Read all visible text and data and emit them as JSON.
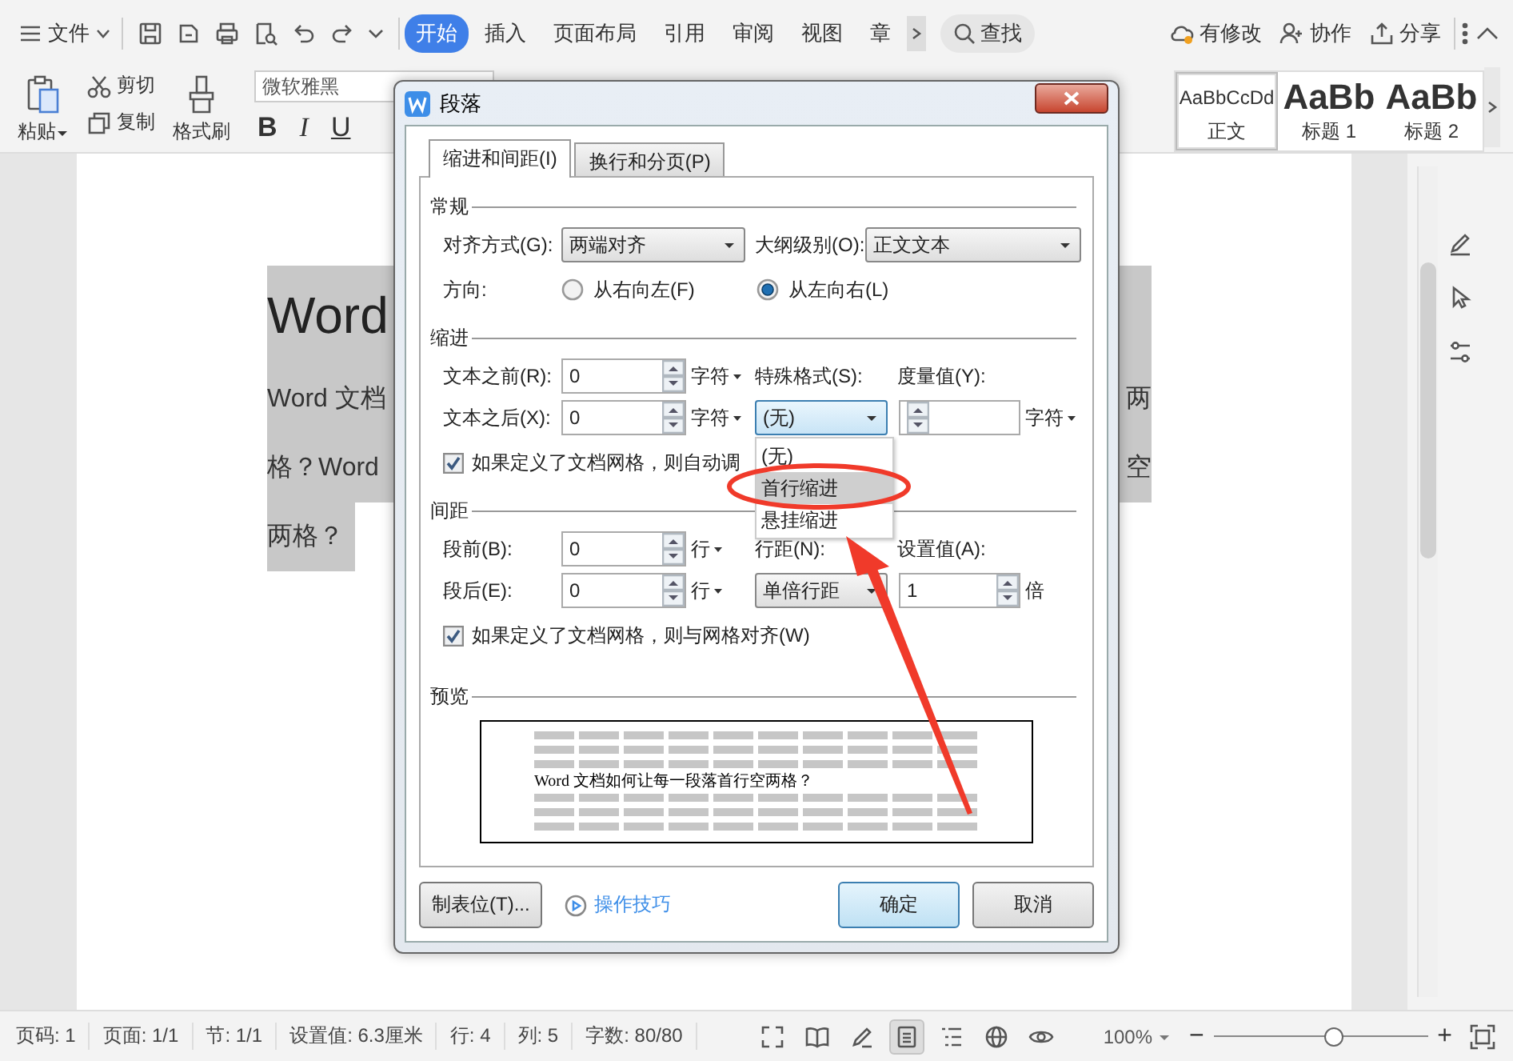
{
  "top_bar": {
    "file_menu": "文件"
  },
  "ribbon_tabs": [
    {
      "label": "开始",
      "selected": true
    },
    {
      "label": "插入",
      "selected": false
    },
    {
      "label": "页面布局",
      "selected": false
    },
    {
      "label": "引用",
      "selected": false
    },
    {
      "label": "审阅",
      "selected": false
    },
    {
      "label": "视图",
      "selected": false
    },
    {
      "label": "章",
      "selected": false
    }
  ],
  "search": {
    "label": "查找"
  },
  "right_actions": [
    {
      "kind": "cloud",
      "label": "有修改"
    },
    {
      "kind": "people",
      "label": "协作"
    },
    {
      "kind": "share",
      "label": "分享"
    }
  ],
  "ribbon": {
    "paste": "粘贴",
    "cut": "剪切",
    "copy": "复制",
    "format_painter": "格式刷",
    "font_name": "微软雅黑",
    "format_buttons": [
      {
        "kind": "bold",
        "label": "B"
      },
      {
        "kind": "italic",
        "label": "I"
      },
      {
        "kind": "underline",
        "label": "U"
      }
    ],
    "styles": [
      {
        "sample": "AaBbCcDd",
        "name": "正文",
        "selected": true
      },
      {
        "sample": "AaBb",
        "name": "标题 1",
        "selected": false
      },
      {
        "sample": "AaBb",
        "name": "标题 2",
        "selected": false
      }
    ]
  },
  "document": {
    "title": "Word",
    "lines": [
      {
        "left": "Word 文档",
        "right": "两"
      },
      {
        "left": "格？Word",
        "right": "空"
      },
      {
        "left": "两格？"
      }
    ]
  },
  "dialog": {
    "title": "段落",
    "tabs": [
      {
        "label": "缩进和间距(I)",
        "selected": true
      },
      {
        "label": "换行和分页(P)",
        "selected": false
      }
    ],
    "general": {
      "heading": "常规",
      "alignment": {
        "label": "对齐方式(G):",
        "value": "两端对齐"
      },
      "outline": {
        "label": "大纲级别(O):",
        "value": "正文文本"
      },
      "direction": {
        "label": "方向:",
        "options": [
          {
            "label": "从右向左(F)",
            "selected": false
          },
          {
            "label": "从左向右(L)",
            "selected": true
          }
        ]
      }
    },
    "indent": {
      "heading": "缩进",
      "before": {
        "label": "文本之前(R):",
        "value": "0",
        "unit": "字符"
      },
      "after": {
        "label": "文本之后(X):",
        "value": "0",
        "unit": "字符"
      },
      "special": {
        "label": "特殊格式(S):",
        "value": "(无)",
        "expanded": true,
        "options": [
          {
            "label": "(无)",
            "highlighted": false
          },
          {
            "label": "首行缩进",
            "highlighted": true
          },
          {
            "label": "悬挂缩进",
            "highlighted": false
          }
        ]
      },
      "measure": {
        "label": "度量值(Y):",
        "unit": "字符"
      },
      "grid_check": {
        "label": "如果定义了文档网格，则自动调",
        "checked": true
      }
    },
    "spacing": {
      "heading": "间距",
      "before": {
        "label": "段前(B):",
        "value": "0",
        "unit": "行"
      },
      "after": {
        "label": "段后(E):",
        "value": "0",
        "unit": "行"
      },
      "line_spacing": {
        "label": "行距(N):",
        "value": "单倍行距"
      },
      "setting": {
        "label": "设置值(A):",
        "value": "1",
        "unit": "倍"
      },
      "grid_check": {
        "label": "如果定义了文档网格，则与网格对齐(W)",
        "checked": true
      }
    },
    "preview": {
      "heading": "预览",
      "sample": "Word 文档如何让每一段落首行空两格？"
    },
    "buttons": {
      "tab_stops": "制表位(T)...",
      "tips": "操作技巧",
      "ok": "确定",
      "cancel": "取消"
    }
  },
  "status_bar": {
    "fields": [
      "页码: 1",
      "页面: 1/1",
      "节: 1/1",
      "设置值: 6.3厘米",
      "行: 4",
      "列: 5",
      "字数: 80/80"
    ],
    "view_modes": [
      {
        "kind": "fullscreen",
        "selected": false
      },
      {
        "kind": "reading",
        "selected": false
      },
      {
        "kind": "edit",
        "selected": false
      },
      {
        "kind": "page",
        "selected": true
      },
      {
        "kind": "outline",
        "selected": false
      },
      {
        "kind": "web",
        "selected": false
      },
      {
        "kind": "eye",
        "selected": false
      }
    ],
    "zoom": "100%",
    "zoom_out": "−",
    "zoom_slider": {
      "level": 0.56
    },
    "zoom_in": "+"
  }
}
